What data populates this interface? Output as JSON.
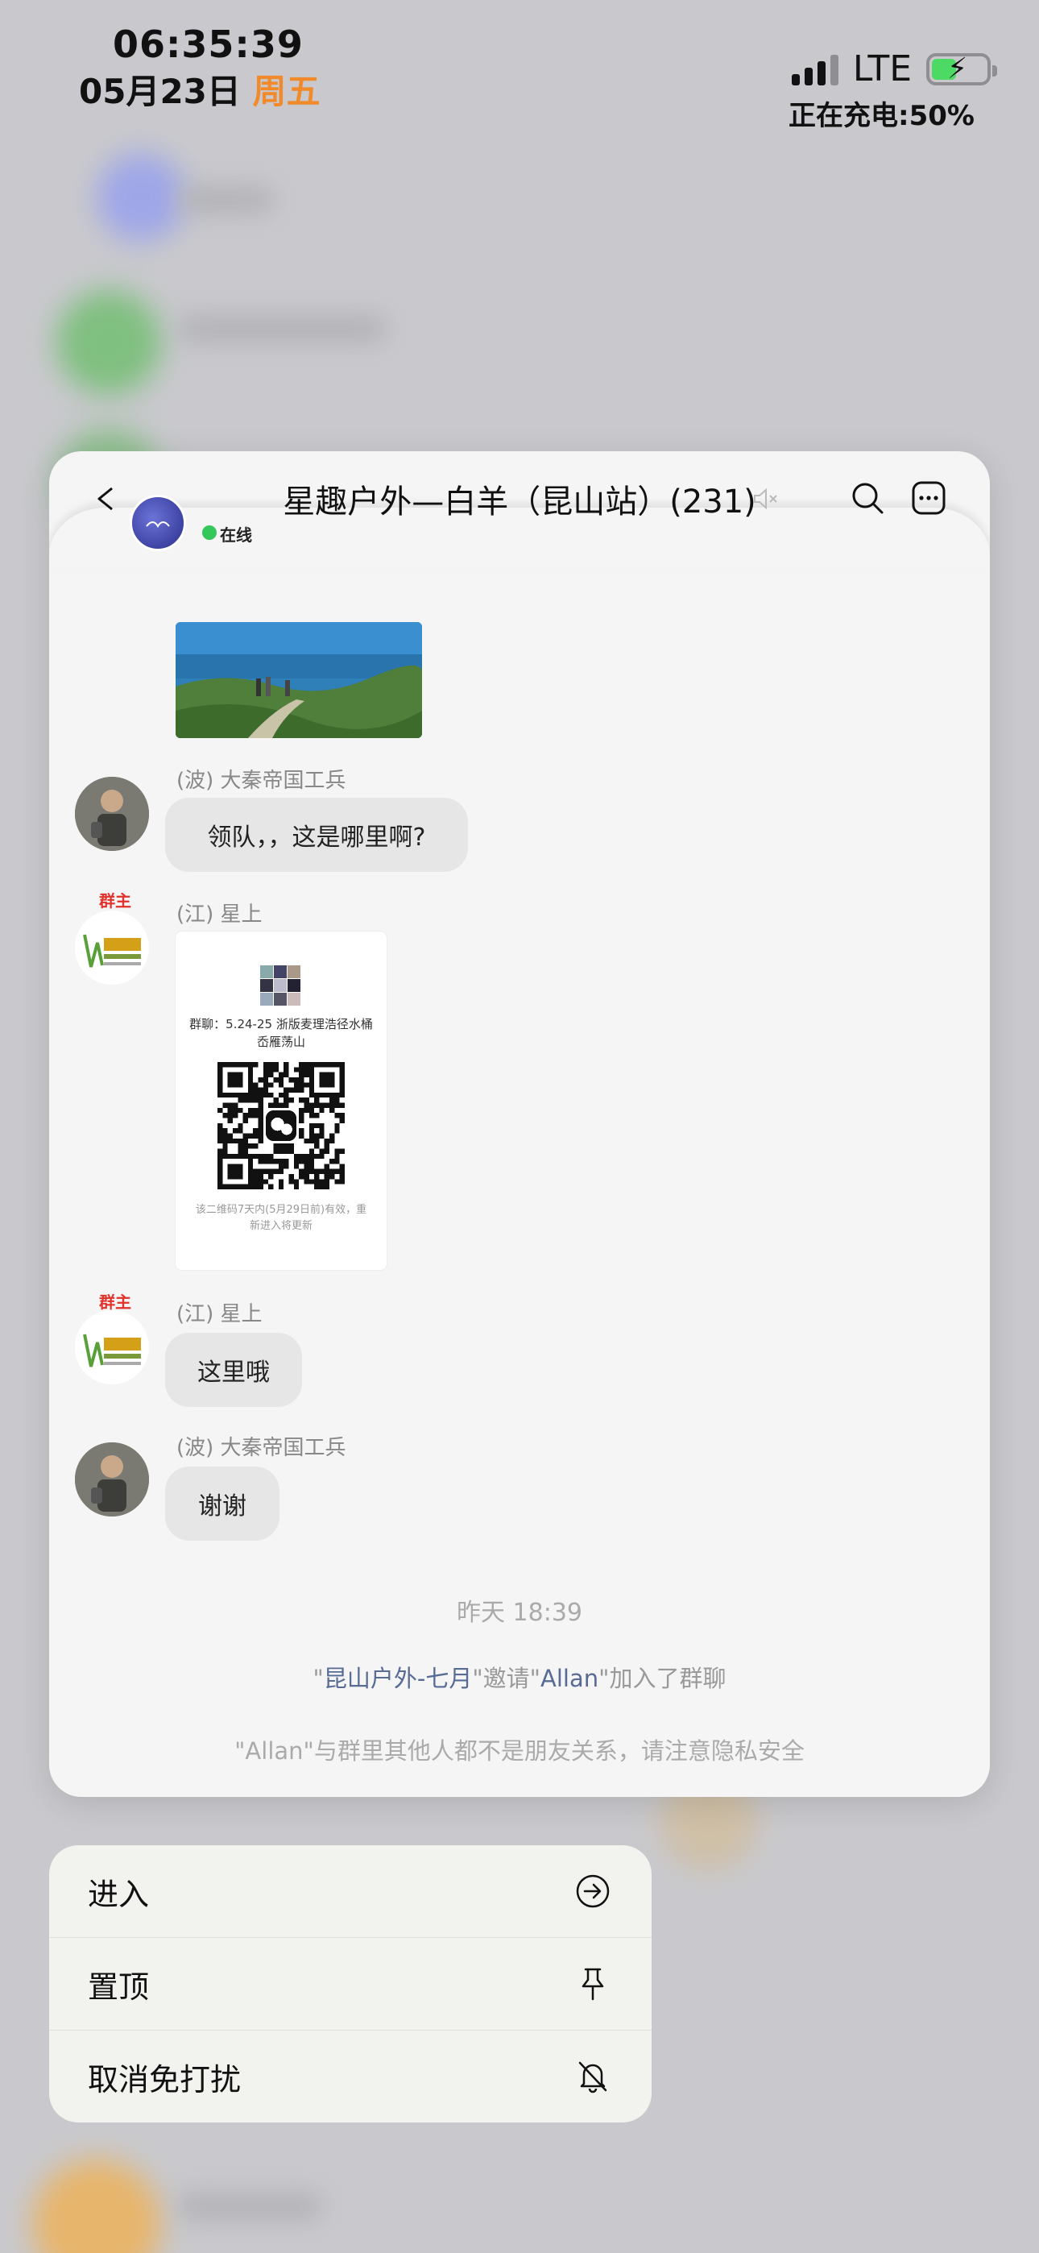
{
  "status_bar": {
    "time": "06:35:39",
    "date": "05月23日",
    "weekday": "周五",
    "network": "LTE",
    "charging_label": "正在充电:50%",
    "battery_level": 0.5
  },
  "chat_preview": {
    "title": "星趣户外—白羊（昆山站）(231)",
    "online_label": "在线",
    "messages": [
      {
        "sender": "(波) 大秦帝国工兵",
        "text": "领队，，这是哪里啊?"
      },
      {
        "sender": "(江) 星上",
        "owner_tag": "群主",
        "qr_caption": "群聊：5.24-25 浙版麦理浩径水桶岙雁荡山",
        "qr_note": "该二维码7天内(5月29日前)有效，重新进入将更新"
      },
      {
        "sender": "(江) 星上",
        "owner_tag": "群主",
        "text": "这里哦"
      },
      {
        "sender": "(波) 大秦帝国工兵",
        "text": "谢谢"
      }
    ],
    "system": {
      "time": "昨天 18:39",
      "invite_quote1": "\"",
      "inviter": "昆山户外-七月",
      "invite_mid": "\"邀请\"",
      "invitee": "Allan",
      "invite_end": "\"加入了群聊",
      "privacy": "\"Allan\"与群里其他人都不是朋友关系，请注意隐私安全"
    }
  },
  "context_menu": {
    "items": [
      {
        "label": "进入",
        "icon": "enter-arrow-icon"
      },
      {
        "label": "置顶",
        "icon": "pin-icon"
      },
      {
        "label": "取消免打扰",
        "icon": "bell-off-icon"
      }
    ]
  }
}
